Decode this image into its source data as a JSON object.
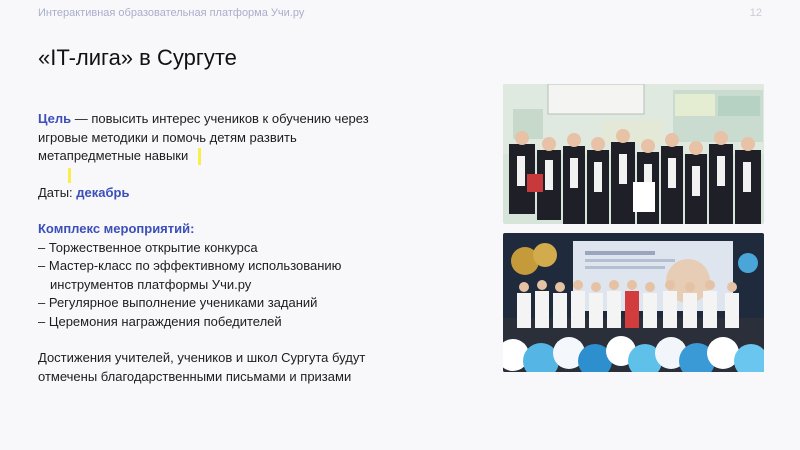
{
  "header": {
    "platform": "Интерактивная образовательная платформа Учи.ру",
    "page_number": "12"
  },
  "title": "«IT-лига» в Сургуте",
  "goal": {
    "label": "Цель",
    "lines": [
      " — повысить интерес учеников к обучению через",
      "игровые методики и помочь детям развить",
      "метапредметные навыки"
    ]
  },
  "dates": {
    "label": "Даты: ",
    "value": "декабрь"
  },
  "events": {
    "heading": "Комплекс мероприятий:",
    "items": [
      "– Торжественное открытие конкурса",
      "– Мастер-класс по эффективному использованию",
      "инструментов платформы Учи.ру",
      "– Регулярное выполнение учениками заданий",
      "– Церемония награждения победителей"
    ]
  },
  "closing": [
    "Достижения учителей, учеников и школ Сургута будут",
    "отмечены благодарственными письмами и призами"
  ],
  "colors": {
    "accent": "#3b4fb8",
    "highlight": "#f7f04a",
    "header": "#a9aecb"
  }
}
